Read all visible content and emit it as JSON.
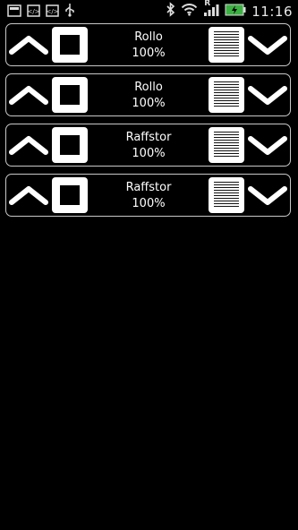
{
  "status_bar": {
    "time": "11:16",
    "signal_letter": "R",
    "left_icons": [
      "notification-square-icon",
      "code-notification-icon",
      "code-notification-icon",
      "usb-icon"
    ],
    "right_icons": [
      "bluetooth-icon",
      "wifi-icon",
      "signal-icon",
      "battery-charging-icon"
    ]
  },
  "blinds": [
    {
      "name": "Rollo",
      "position": "100%"
    },
    {
      "name": "Rollo",
      "position": "100%"
    },
    {
      "name": "Raffstor",
      "position": "100%"
    },
    {
      "name": "Raffstor",
      "position": "100%"
    }
  ],
  "colors": {
    "background": "#000000",
    "foreground": "#ffffff",
    "border": "#c8c8c8",
    "battery_green": "#3cb043"
  }
}
